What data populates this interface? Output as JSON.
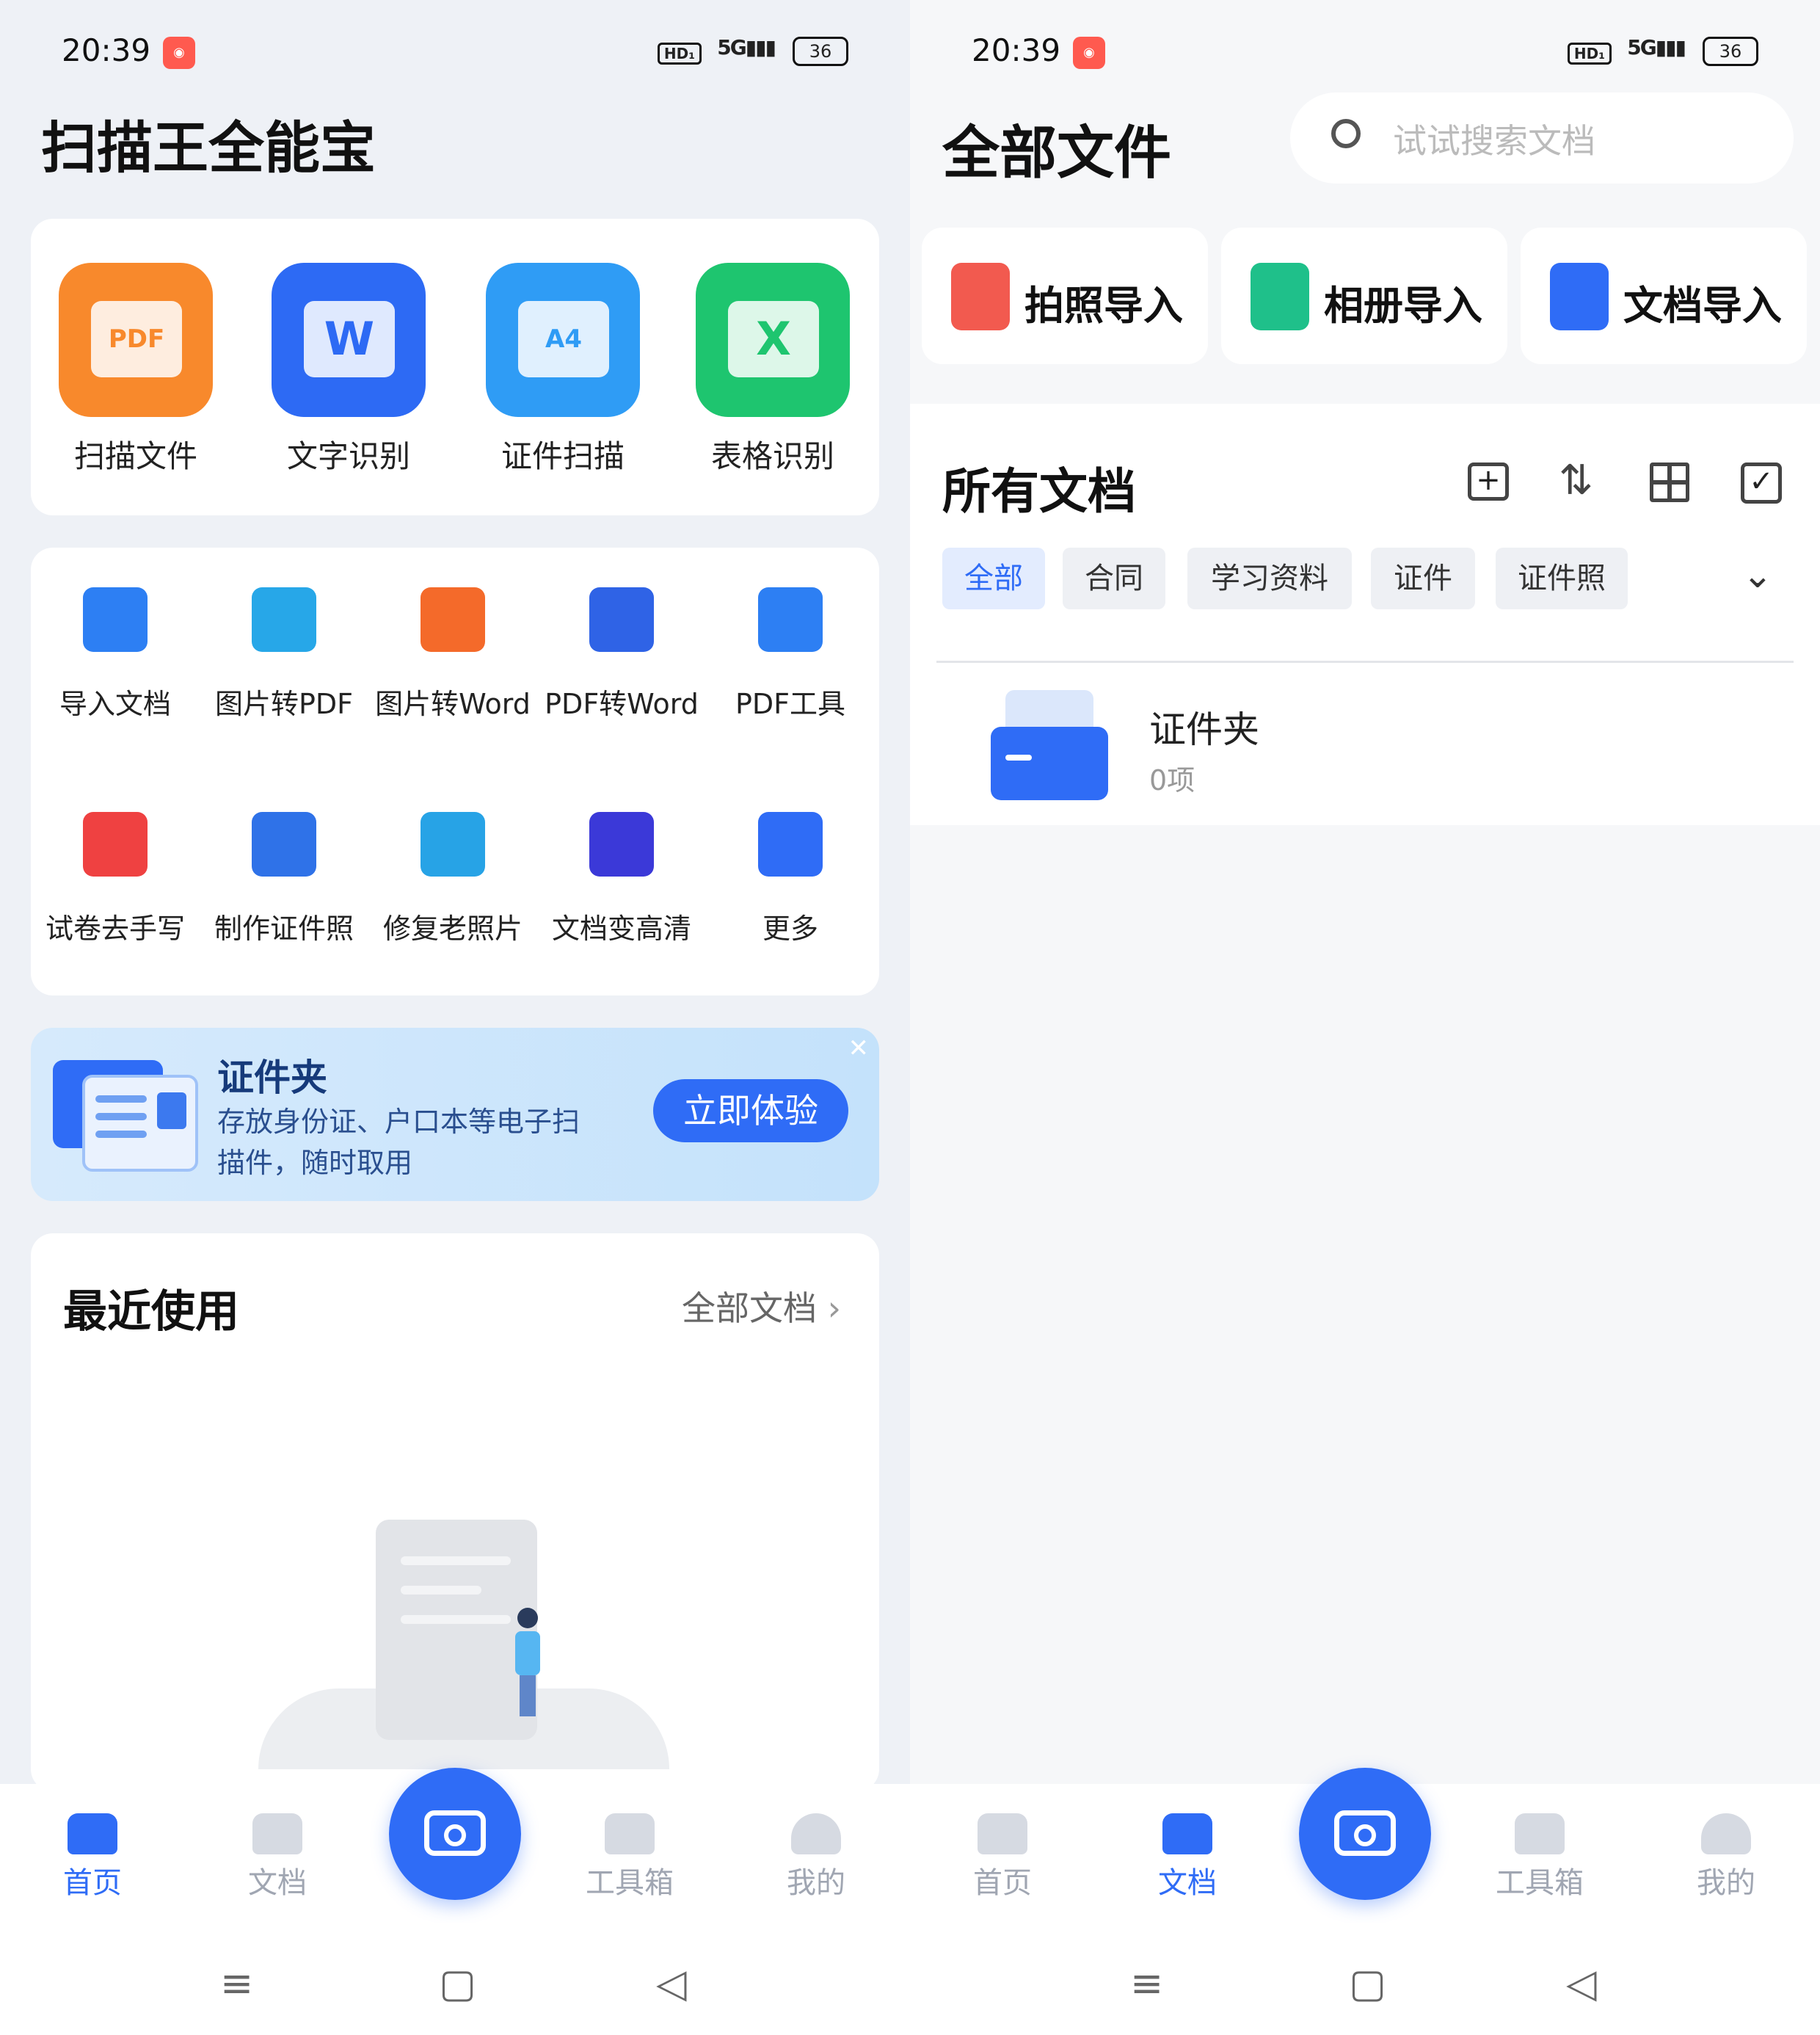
{
  "status": {
    "time": "20:39",
    "network": "5G",
    "hd": "HD₁",
    "battery": "36"
  },
  "left": {
    "title": "扫描王全能宝",
    "main_tools": [
      {
        "label": "扫描文件",
        "icon": "pdf-scan-icon",
        "color": "#f8892c",
        "badge": "PDF"
      },
      {
        "label": "文字识别",
        "icon": "word-ocr-icon",
        "color": "#2d6af4",
        "badge": "W"
      },
      {
        "label": "证件扫描",
        "icon": "id-scan-icon",
        "color": "#2f9cf5",
        "badge": "A4"
      },
      {
        "label": "表格识别",
        "icon": "excel-icon",
        "color": "#1ec56f",
        "badge": "X"
      }
    ],
    "tools_row1": [
      {
        "label": "导入文档",
        "icon": "import-doc-icon",
        "color": "#2d7ff3"
      },
      {
        "label": "图片转PDF",
        "icon": "image-to-pdf-icon",
        "color": "#27a7e8"
      },
      {
        "label": "图片转Word",
        "icon": "image-to-word-icon",
        "color": "#f46a2a"
      },
      {
        "label": "PDF转Word",
        "icon": "pdf-to-word-icon",
        "color": "#2f63e6"
      },
      {
        "label": "PDF工具",
        "icon": "toolbox-icon",
        "color": "#2d7ff3"
      }
    ],
    "tools_row2": [
      {
        "label": "试卷去手写",
        "icon": "remove-handwriting-icon",
        "color": "#ef4141"
      },
      {
        "label": "制作证件照",
        "icon": "id-photo-icon",
        "color": "#2f72e8"
      },
      {
        "label": "修复老照片",
        "icon": "magic-wand-icon",
        "color": "#27a3e6"
      },
      {
        "label": "文档变高清",
        "icon": "hd-icon",
        "color": "#3b39d8"
      },
      {
        "label": "更多",
        "icon": "grid-more-icon",
        "color": "#2f6cf6"
      }
    ],
    "banner": {
      "title": "证件夹",
      "desc": "存放身份证、户口本等电子扫描件，随时取用",
      "desc_line1": "存放身份证、户口本等电子扫",
      "desc_line2": "描件，随时取用",
      "button": "立即体验"
    },
    "recent": {
      "title": "最近使用",
      "link": "全部文档"
    }
  },
  "right": {
    "title": "全部文件",
    "search_placeholder": "试试搜索文档",
    "quick": [
      {
        "label": "拍照导入",
        "icon": "camera-import-icon",
        "color": "#f25a4f"
      },
      {
        "label": "相册导入",
        "icon": "album-import-icon",
        "color": "#1fc08a"
      },
      {
        "label": "文档导入",
        "icon": "doc-import-icon",
        "color": "#2f6cf6"
      }
    ],
    "section_title": "所有文档",
    "chips": [
      "全部",
      "合同",
      "学习资料",
      "证件",
      "证件照"
    ],
    "folder": {
      "name": "证件夹",
      "count": "0项"
    }
  },
  "tabs": [
    "首页",
    "文档",
    "工具箱",
    "我的"
  ],
  "accent": "#2f6cf6"
}
